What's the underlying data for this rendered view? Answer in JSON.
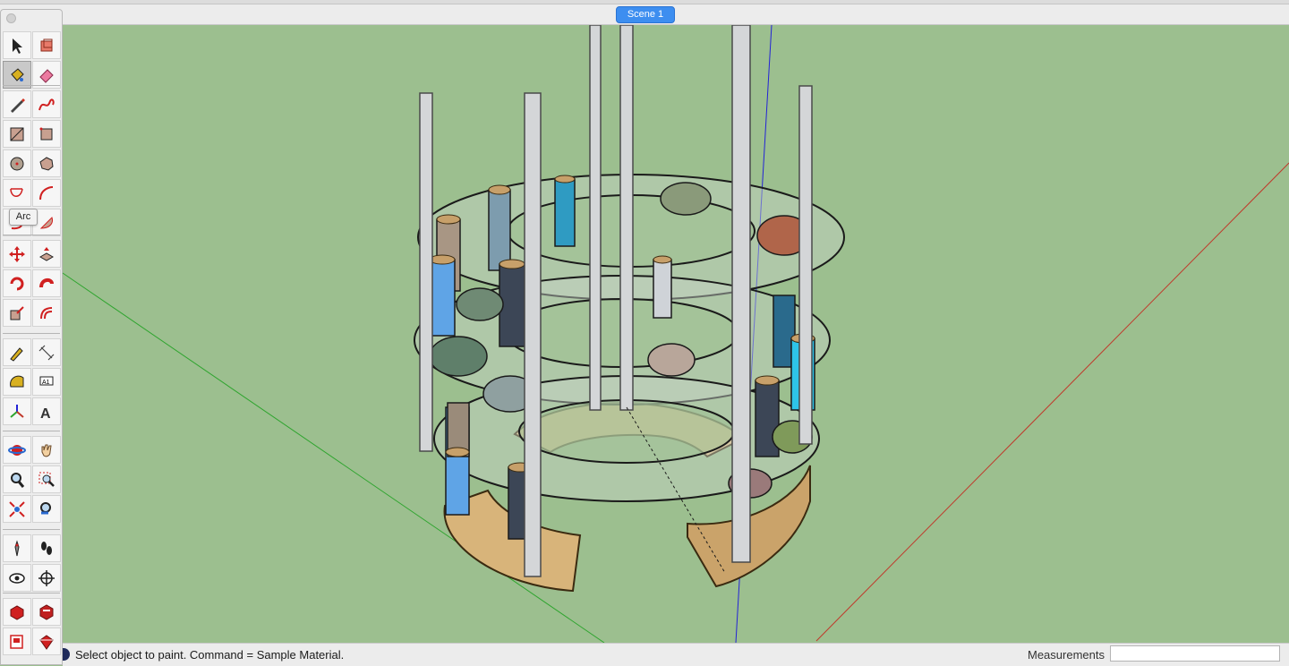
{
  "window": {
    "scene_tab": "Scene 1"
  },
  "toolbar": {
    "tooltip": "Arc",
    "tools": [
      {
        "name": "select-tool",
        "icon": "arrow-cursor-icon"
      },
      {
        "name": "make-component-tool",
        "icon": "component-box-icon"
      },
      {
        "name": "paint-bucket-tool",
        "icon": "paint-bucket-icon",
        "active": true
      },
      {
        "name": "eraser-tool",
        "icon": "eraser-icon"
      },
      {
        "name": "line-tool",
        "icon": "pencil-icon"
      },
      {
        "name": "freehand-tool",
        "icon": "freehand-curve-icon"
      },
      {
        "name": "rectangle-tool",
        "icon": "rectangle-icon"
      },
      {
        "name": "rotated-rectangle-tool",
        "icon": "rotated-rectangle-icon"
      },
      {
        "name": "circle-tool",
        "icon": "circle-icon"
      },
      {
        "name": "polygon-tool",
        "icon": "polygon-icon"
      },
      {
        "name": "arc-tool",
        "icon": "arc-icon"
      },
      {
        "name": "two-point-arc-tool",
        "icon": "two-point-arc-icon"
      },
      {
        "name": "three-point-arc-tool",
        "icon": "three-point-arc-icon"
      },
      {
        "name": "pie-tool",
        "icon": "pie-icon"
      },
      {
        "name": "move-tool",
        "icon": "move-arrows-icon"
      },
      {
        "name": "push-pull-tool",
        "icon": "push-pull-icon"
      },
      {
        "name": "rotate-tool",
        "icon": "rotate-icon"
      },
      {
        "name": "follow-me-tool",
        "icon": "follow-me-icon"
      },
      {
        "name": "scale-tool",
        "icon": "scale-icon"
      },
      {
        "name": "offset-tool",
        "icon": "offset-icon"
      },
      {
        "name": "tape-measure-tool",
        "icon": "tape-measure-icon"
      },
      {
        "name": "dimension-tool",
        "icon": "dimension-icon"
      },
      {
        "name": "protractor-tool",
        "icon": "protractor-icon"
      },
      {
        "name": "text-tool",
        "icon": "text-a1-icon"
      },
      {
        "name": "axes-tool",
        "icon": "axes-icon"
      },
      {
        "name": "3d-text-tool",
        "icon": "3d-text-icon"
      },
      {
        "name": "orbit-tool",
        "icon": "orbit-icon"
      },
      {
        "name": "pan-tool",
        "icon": "hand-icon"
      },
      {
        "name": "zoom-tool",
        "icon": "magnifier-icon"
      },
      {
        "name": "zoom-window-tool",
        "icon": "zoom-window-icon"
      },
      {
        "name": "zoom-extents-tool",
        "icon": "zoom-extents-icon"
      },
      {
        "name": "previous-view-tool",
        "icon": "previous-view-icon"
      },
      {
        "name": "position-camera-tool",
        "icon": "position-camera-icon"
      },
      {
        "name": "walk-tool",
        "icon": "footprints-icon"
      },
      {
        "name": "look-around-tool",
        "icon": "eye-icon"
      },
      {
        "name": "section-plane-tool",
        "icon": "section-plane-icon"
      },
      {
        "name": "3d-warehouse-tool",
        "icon": "warehouse-icon"
      },
      {
        "name": "extension-warehouse-tool",
        "icon": "extension-warehouse-icon"
      },
      {
        "name": "layout-tool",
        "icon": "layout-icon"
      },
      {
        "name": "extension-manager-tool",
        "icon": "ruby-gem-icon"
      }
    ]
  },
  "statusbar": {
    "message": "Select object to paint. Command = Sample Material.",
    "measurements_label": "Measurements",
    "measurements_value": ""
  },
  "colors": {
    "background": "#9cbf8f",
    "axis_red": "#c0392b",
    "axis_green": "#2fa52f",
    "axis_blue": "#2323d6",
    "scene_tab": "#3d8ef0"
  }
}
